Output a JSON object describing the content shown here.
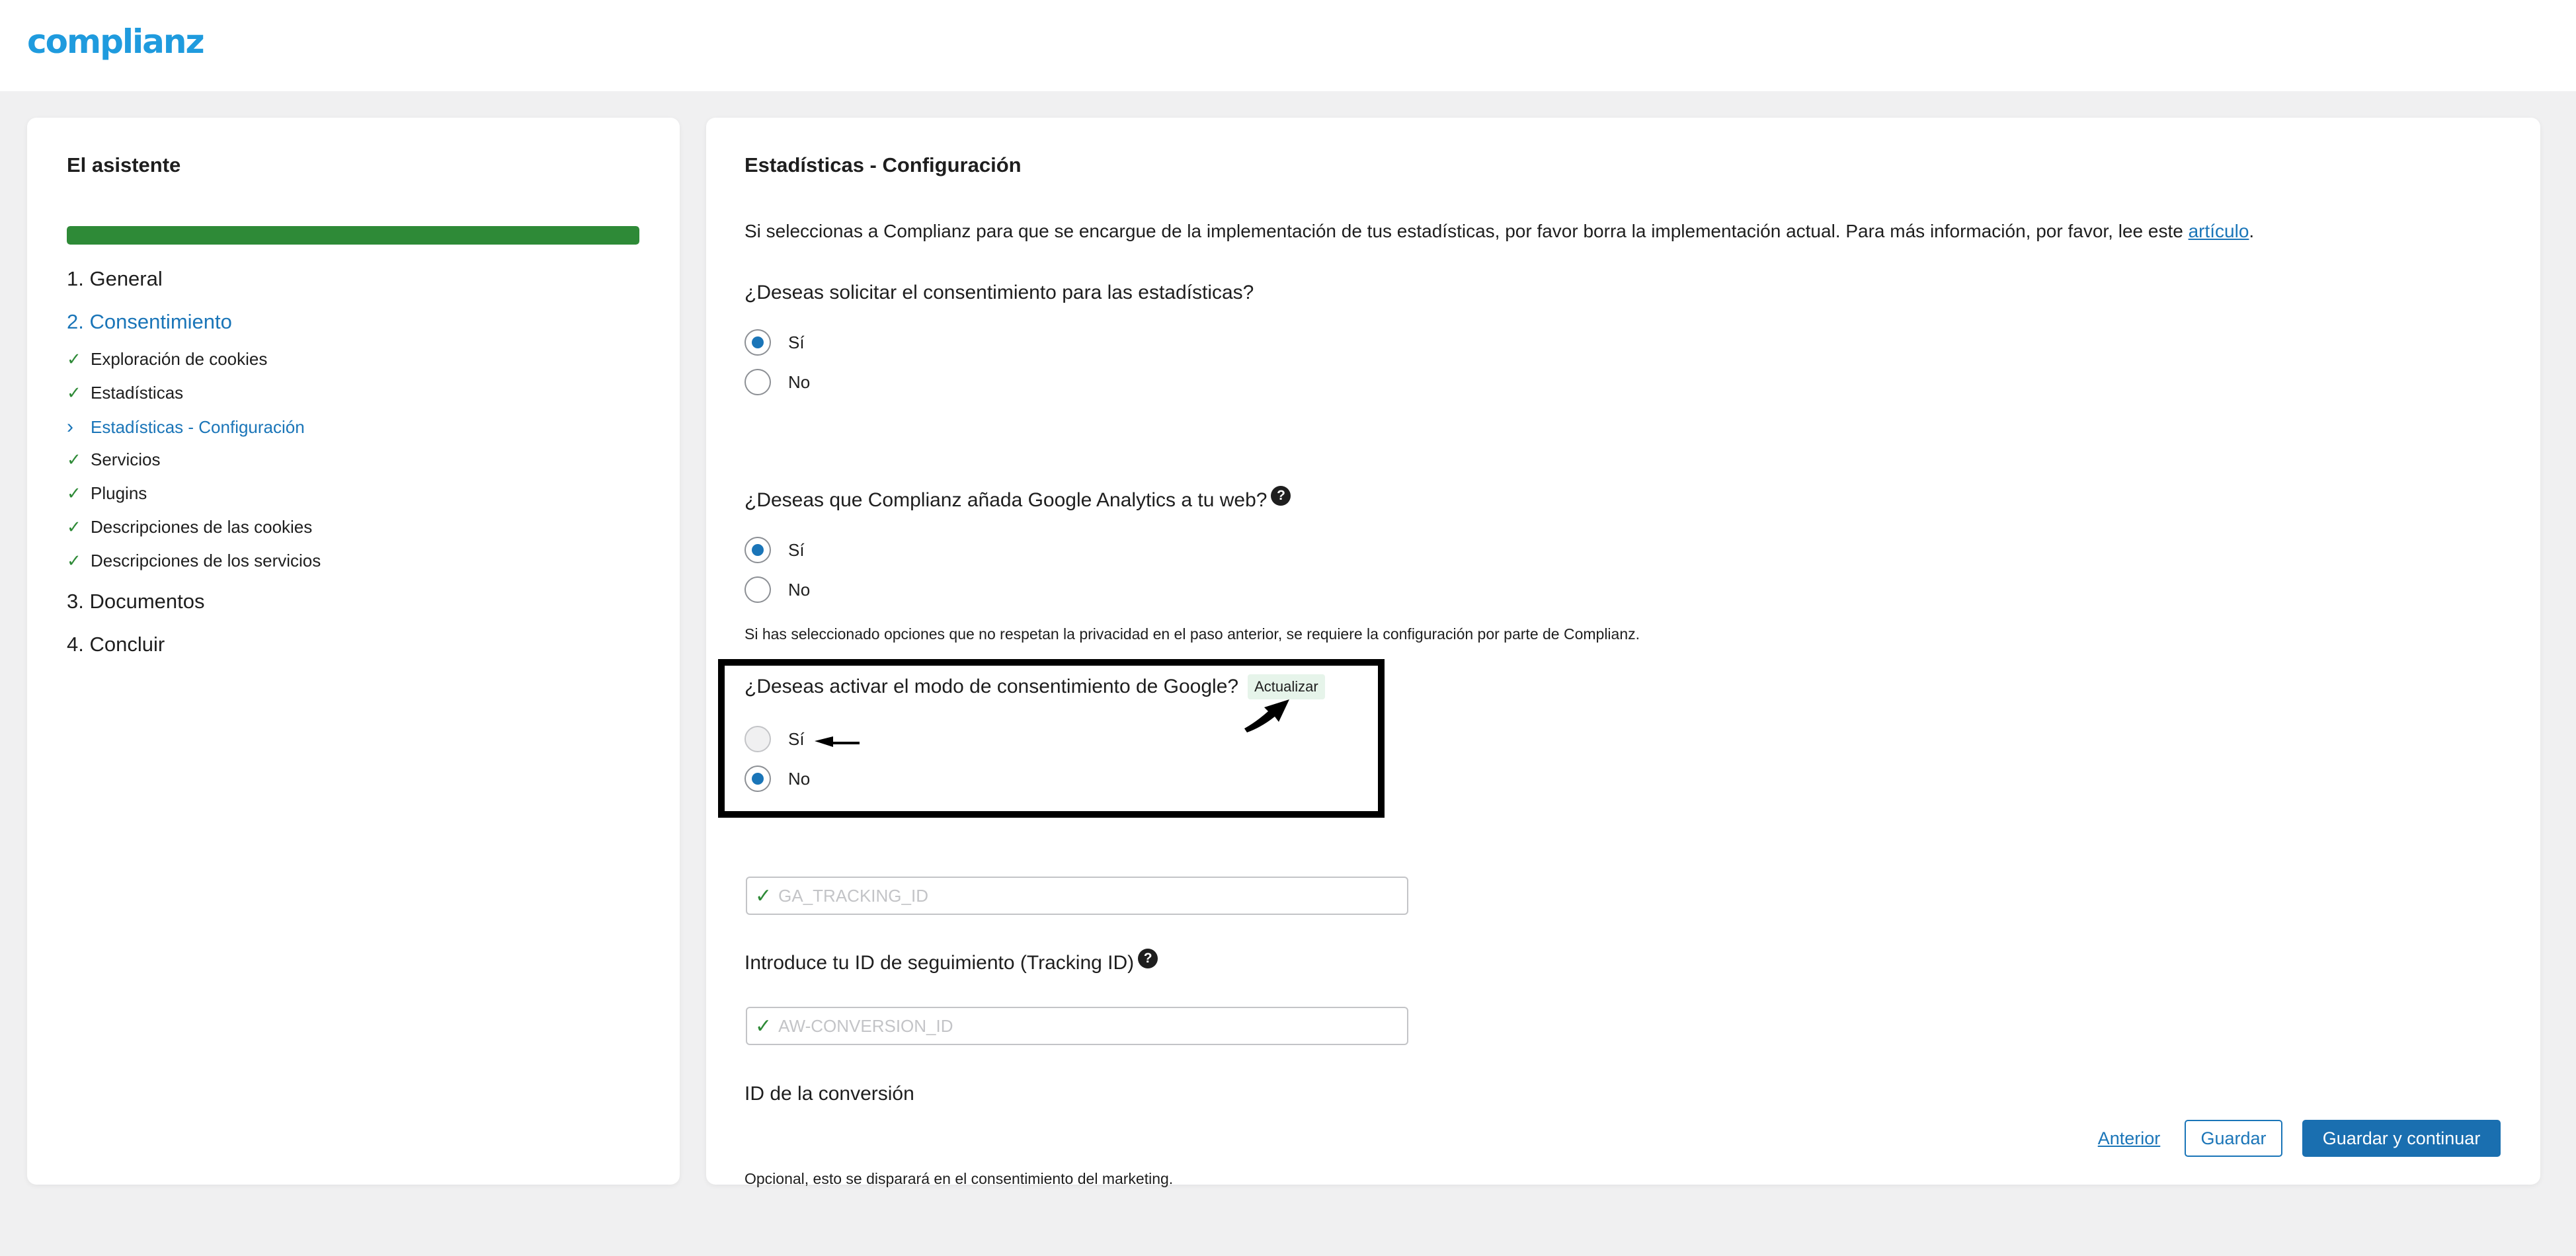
{
  "app": {
    "logo": "complianz"
  },
  "sidebar": {
    "title": "El asistente",
    "progress": 1.0,
    "steps": [
      {
        "label": "1. General"
      },
      {
        "label": "2. Consentimiento"
      },
      {
        "label": "3. Documentos"
      },
      {
        "label": "4. Concluir"
      }
    ],
    "sub_items": [
      {
        "label": "Exploración de cookies",
        "state": "done"
      },
      {
        "label": "Estadísticas",
        "state": "done"
      },
      {
        "label": "Estadísticas - Configuración",
        "state": "current"
      },
      {
        "label": "Servicios",
        "state": "done"
      },
      {
        "label": "Plugins",
        "state": "done"
      },
      {
        "label": "Descripciones de las cookies",
        "state": "done"
      },
      {
        "label": "Descripciones de los servicios",
        "state": "done"
      }
    ]
  },
  "main": {
    "title": "Estadísticas - Configuración",
    "intro_text": "Si seleccionas a Complianz para que se encargue de la implementación de tus estadísticas, por favor borra la implementación actual. Para más información, por favor, lee este ",
    "intro_link": "artículo",
    "intro_end": ".",
    "q1": {
      "label": "¿Deseas solicitar el consentimiento para las estadísticas?",
      "opt_yes": "Sí",
      "opt_no": "No",
      "selected": "Sí"
    },
    "q2": {
      "label": "¿Deseas que Complianz añada Google Analytics a tu web?",
      "help": "?",
      "opt_yes": "Sí",
      "opt_no": "No",
      "selected": "Sí",
      "note": "Si has seleccionado opciones que no respetan la privacidad en el paso anterior, se requiere la configuración por parte de Complianz."
    },
    "q3": {
      "label": "¿Deseas activar el modo de consentimiento de Google?",
      "badge": "Actualizar",
      "opt_yes": "Sí",
      "opt_no": "No",
      "selected": "No"
    },
    "tracking": {
      "label": "Introduce tu ID de seguimiento (Tracking ID)",
      "help": "?",
      "placeholder": "GA_TRACKING_ID",
      "value": ""
    },
    "conversion": {
      "label": "ID de la conversión",
      "placeholder": "AW-CONVERSION_ID",
      "value": "",
      "note": "Opcional, esto se disparará en el consentimiento del marketing."
    },
    "buttons": {
      "previous": "Anterior",
      "save": "Guardar",
      "save_continue": "Guardar y continuar"
    }
  },
  "colors": {
    "brand": "#1f9bde",
    "accent": "#1a75b8",
    "success": "#2e8a37"
  },
  "icons": {
    "check": "check-icon",
    "chevron": "chevron-right-icon",
    "help": "help-icon",
    "annotation": "arrow-annotation"
  }
}
